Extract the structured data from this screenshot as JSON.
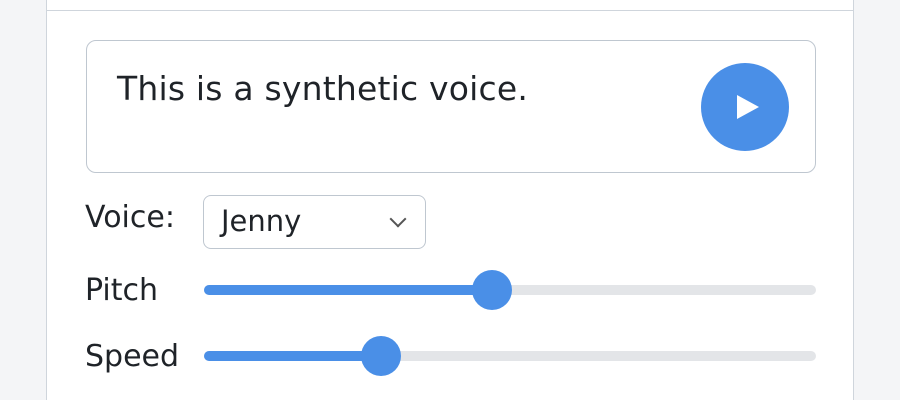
{
  "tts": {
    "text": "This is a synthetic voice.",
    "play_icon": "play-icon",
    "voice_label": "Voice:",
    "voice_value": "Jenny",
    "pitch_label": "Pitch",
    "pitch_level": 0.47,
    "speed_label": "Speed",
    "speed_level": 0.29
  },
  "colors": {
    "accent": "#4a8fe7",
    "track": "#e3e5e8",
    "border": "#bfc7d0"
  }
}
